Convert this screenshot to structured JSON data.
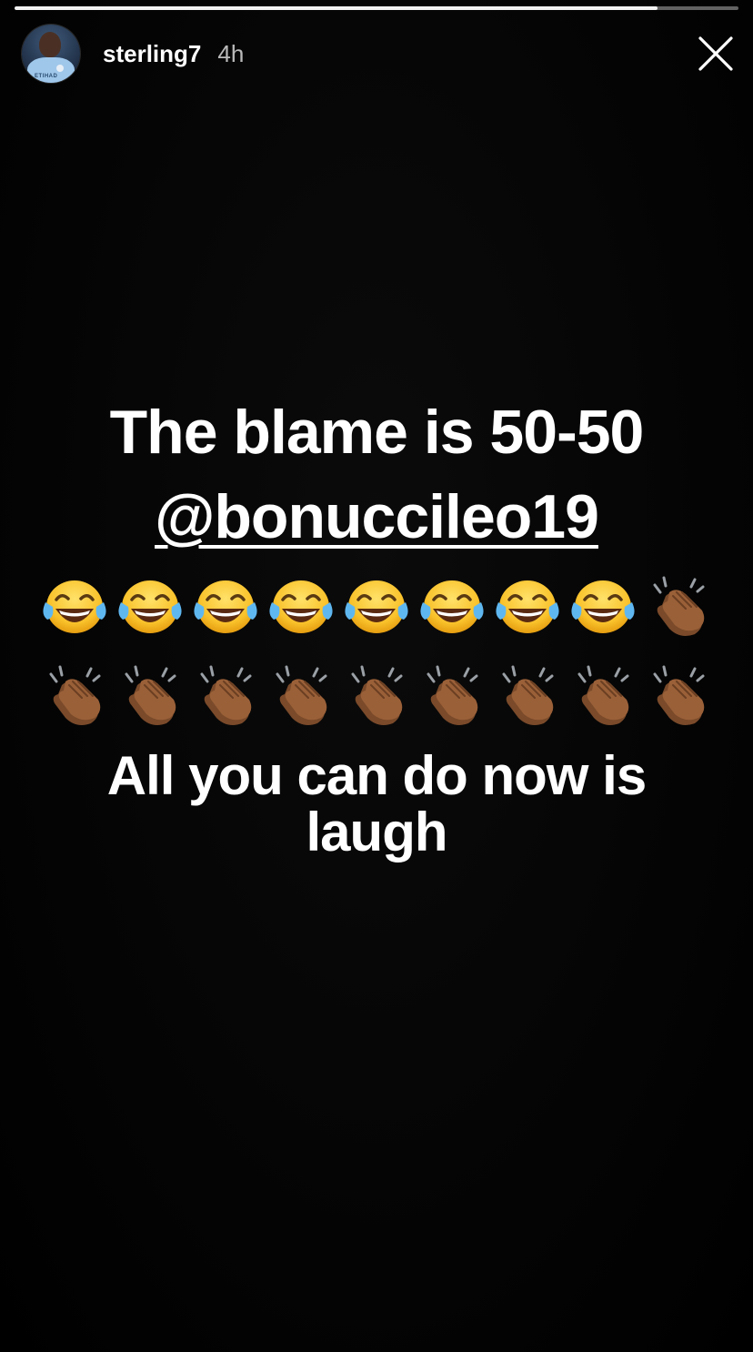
{
  "story": {
    "progress_fraction": 0.888,
    "user": {
      "username": "sterling7",
      "timestamp": "4h",
      "avatar_sponsor_text": "ETIHAD"
    },
    "close_icon": "close-icon"
  },
  "post": {
    "line1": "The blame is 50-50",
    "mention": "@bonuccileo19",
    "emoji_row1": [
      "face-with-tears-of-joy",
      "face-with-tears-of-joy",
      "face-with-tears-of-joy",
      "face-with-tears-of-joy",
      "face-with-tears-of-joy",
      "face-with-tears-of-joy",
      "face-with-tears-of-joy",
      "face-with-tears-of-joy",
      "clapping-hands-medium-dark"
    ],
    "emoji_row2": [
      "clapping-hands-medium-dark",
      "clapping-hands-medium-dark",
      "clapping-hands-medium-dark",
      "clapping-hands-medium-dark",
      "clapping-hands-medium-dark",
      "clapping-hands-medium-dark",
      "clapping-hands-medium-dark",
      "clapping-hands-medium-dark",
      "clapping-hands-medium-dark"
    ],
    "caption": "All you can do now is laugh"
  },
  "colors": {
    "background": "#000000",
    "text": "#ffffff",
    "progress_track": "rgba(255,255,255,0.38)",
    "progress_fill": "#f2f2f2"
  }
}
